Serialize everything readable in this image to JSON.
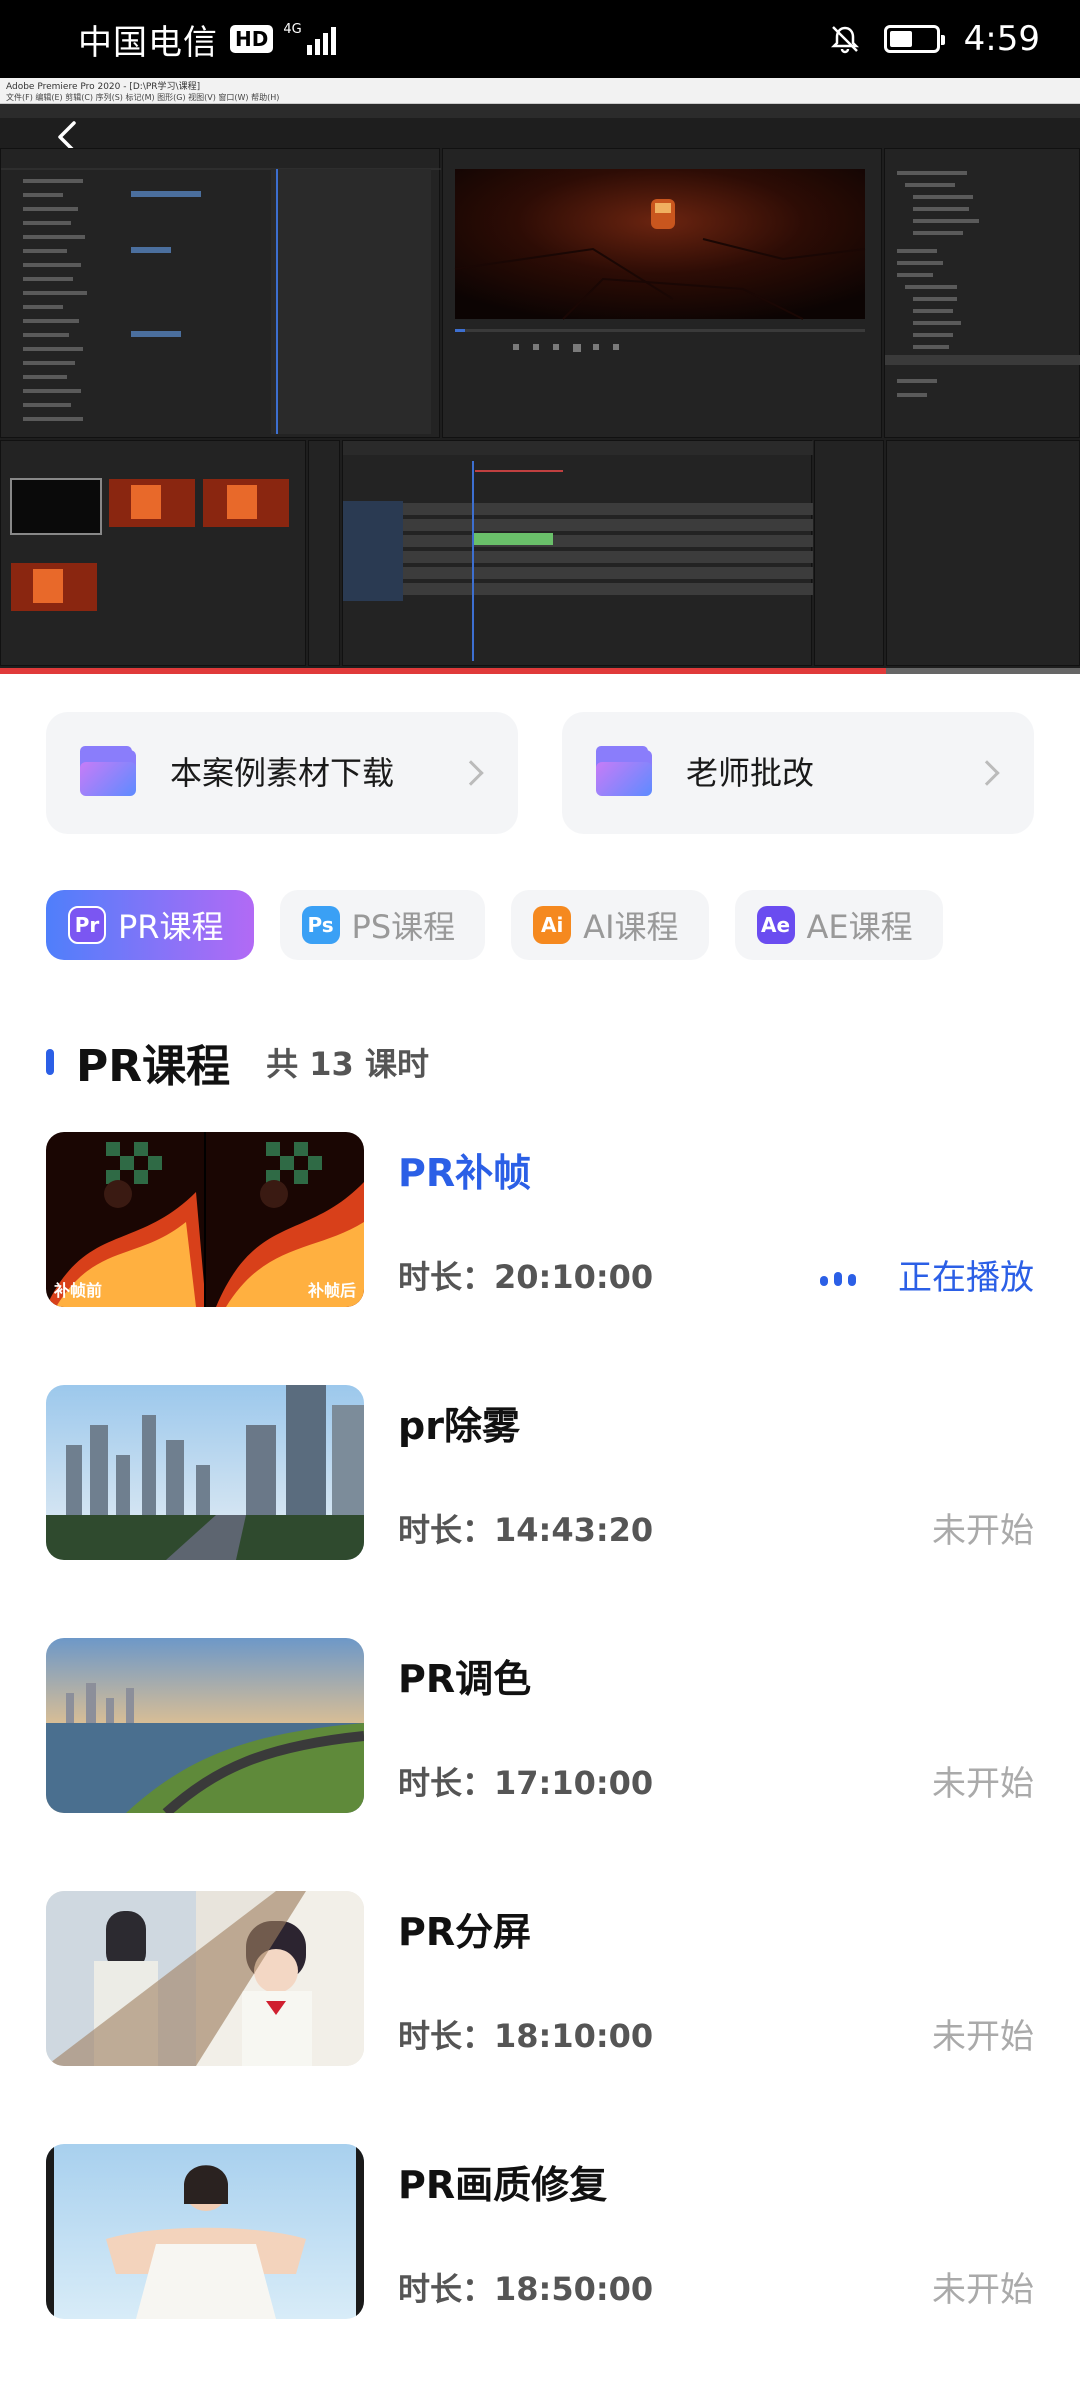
{
  "status_bar": {
    "carrier": "中国电信",
    "hd": "HD",
    "network": "4G",
    "time": "4:59",
    "battery_level": 0.5
  },
  "video": {
    "window_title": "Adobe Premiere Pro 2020 - [D:\\PR学习\\课程]",
    "menu": "文件(F)  编辑(E)  剪辑(C)  序列(S)  标记(M)  图形(G)  视图(V)  窗口(W)  帮助(H)",
    "progress": 0.82
  },
  "actions": [
    {
      "label": "本案例素材下载",
      "icon": "folder-icon"
    },
    {
      "label": "老师批改",
      "icon": "folder-icon"
    }
  ],
  "tabs": [
    {
      "icon_text": "Pr",
      "label": "PR课程",
      "active": true,
      "icon_bg": "#7b56f2",
      "icon_fg": "#ffffff"
    },
    {
      "icon_text": "Ps",
      "label": "PS课程",
      "active": false,
      "icon_bg": "#3aa0f5",
      "icon_fg": "#ffffff"
    },
    {
      "icon_text": "Ai",
      "label": "AI课程",
      "active": false,
      "icon_bg": "#f5891f",
      "icon_fg": "#ffffff"
    },
    {
      "icon_text": "Ae",
      "label": "AE课程",
      "active": false,
      "icon_bg": "#6a4cf0",
      "icon_fg": "#ffffff"
    }
  ],
  "section": {
    "title": "PR课程",
    "count": "共 13 课时"
  },
  "lessons": [
    {
      "title": "PR补帧",
      "duration": "时长：20:10:00",
      "status": "正在播放",
      "playing": true,
      "cap_left": "补帧前",
      "cap_right": "补帧后"
    },
    {
      "title": "pr除雾",
      "duration": "时长：14:43:20",
      "status": "未开始",
      "playing": false
    },
    {
      "title": "PR调色",
      "duration": "时长：17:10:00",
      "status": "未开始",
      "playing": false
    },
    {
      "title": "PR分屏",
      "duration": "时长：18:10:00",
      "status": "未开始",
      "playing": false
    },
    {
      "title": "PR画质修复",
      "duration": "时长：18:50:00",
      "status": "未开始",
      "playing": false
    }
  ],
  "colors": {
    "accent": "#2b5fe6",
    "muted": "#aaaaaa",
    "card_bg": "#f4f5f7"
  }
}
